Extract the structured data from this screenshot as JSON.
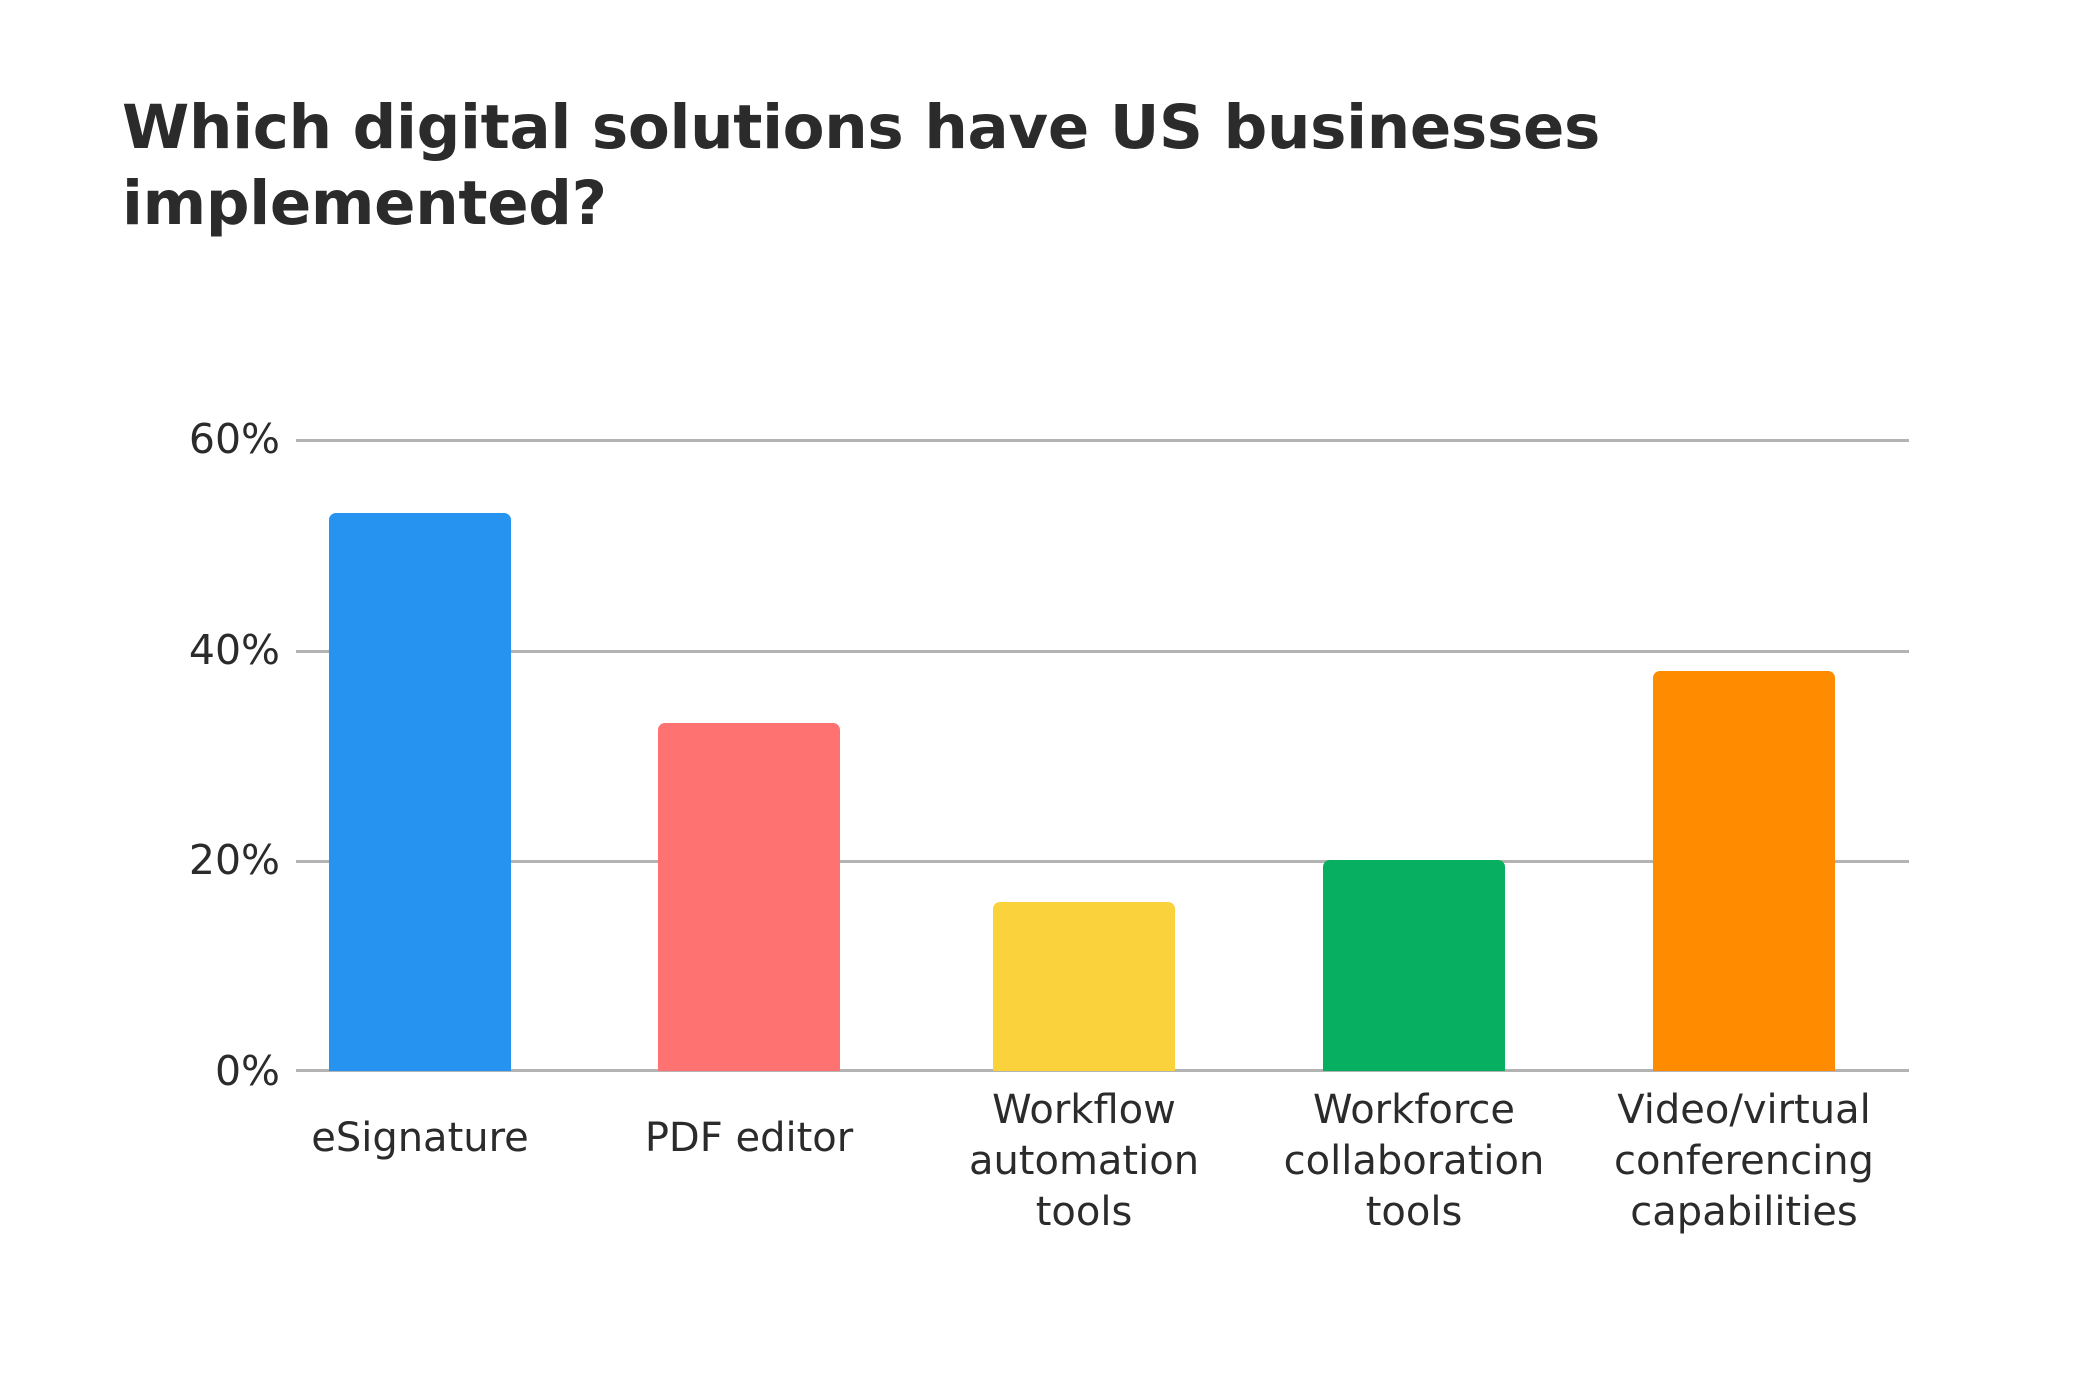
{
  "chart_data": {
    "type": "bar",
    "title": "Which digital solutions have US businesses implemented?",
    "subtitle": "",
    "xlabel": "",
    "ylabel": "",
    "categories": [
      "eSignature",
      "Workflow automation tools",
      "PDF editor",
      "Workforce collaboration tools",
      "Video/virtual conferencing capabilities"
    ],
    "bars": [
      {
        "label": "eSignature",
        "label_lines": [
          "eSignature"
        ],
        "value": 53,
        "value_label": "53%",
        "color": "#2693F0"
      },
      {
        "label": "PDF editor",
        "label_lines": [
          "PDF editor"
        ],
        "value": 33,
        "value_label": "33%",
        "color": "#FF7272"
      },
      {
        "label": "Workflow automation tools",
        "label_lines": [
          "Workflow",
          "automation",
          "tools"
        ],
        "value": 16,
        "value_label": "16%",
        "color": "#FAD23C"
      },
      {
        "label": "Workforce collaboration tools",
        "label_lines": [
          "Workforce",
          "collaboration",
          "tools"
        ],
        "value": 20,
        "value_label": "20%",
        "color": "#07AF60"
      },
      {
        "label": "Video/virtual conferencing capabilities",
        "label_lines": [
          "Video/virtual",
          "conferencing",
          "capabilities"
        ],
        "value": 38,
        "value_label": "38%",
        "color": "#FF8C00"
      }
    ],
    "values": [
      53,
      33,
      16,
      20,
      38
    ],
    "ylim": [
      0,
      60
    ],
    "yticks": [
      0,
      20,
      40,
      60
    ],
    "ytick_labels": [
      "0%",
      "20%",
      "40%",
      "60%"
    ],
    "grid": true,
    "gridline_color": "#b3b3b3",
    "legend": "none",
    "background_color": "#ffffff",
    "text_color": "#2b2b2b"
  }
}
